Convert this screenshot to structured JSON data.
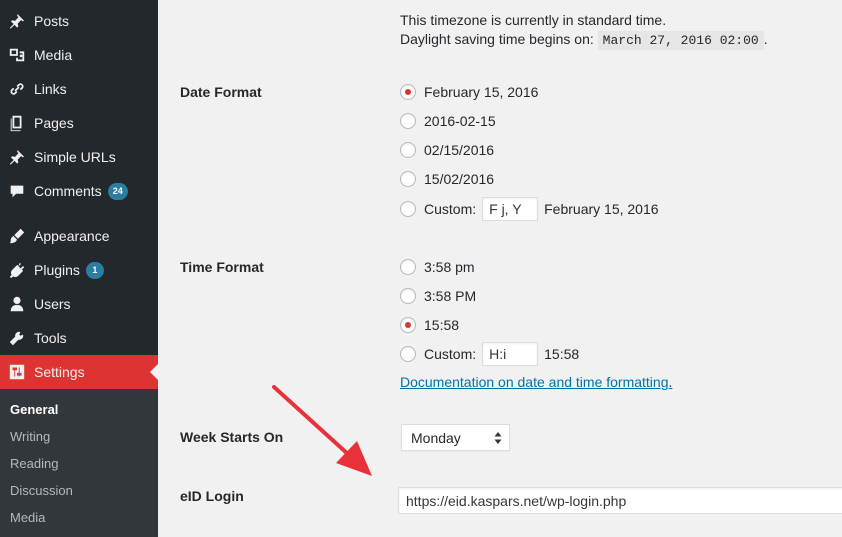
{
  "sidebar": {
    "items": [
      {
        "label": "Posts",
        "icon": "pushpin-icon"
      },
      {
        "label": "Media",
        "icon": "media-icon"
      },
      {
        "label": "Links",
        "icon": "link-icon"
      },
      {
        "label": "Pages",
        "icon": "pages-icon"
      },
      {
        "label": "Simple URLs",
        "icon": "pushpin-icon"
      },
      {
        "label": "Comments",
        "icon": "comment-icon",
        "badge": "24"
      },
      {
        "label": "Appearance",
        "icon": "paintbrush-icon"
      },
      {
        "label": "Plugins",
        "icon": "plugin-icon",
        "badge": "1"
      },
      {
        "label": "Users",
        "icon": "user-icon"
      },
      {
        "label": "Tools",
        "icon": "wrench-icon"
      },
      {
        "label": "Settings",
        "icon": "settings-icon"
      }
    ],
    "submenu": [
      "General",
      "Writing",
      "Reading",
      "Discussion",
      "Media"
    ]
  },
  "timezone": {
    "standard_text": "This timezone is currently in standard time.",
    "dst_prefix": "Daylight saving time begins on:",
    "dst_date": "March 27, 2016 02:00",
    "dst_suffix": "."
  },
  "date_format": {
    "label": "Date Format",
    "options": [
      "February 15, 2016",
      "2016-02-15",
      "02/15/2016",
      "15/02/2016"
    ],
    "custom_label": "Custom:",
    "custom_value": "F j, Y",
    "custom_preview": "February 15, 2016"
  },
  "time_format": {
    "label": "Time Format",
    "options": [
      "3:58 pm",
      "3:58 PM",
      "15:58"
    ],
    "custom_label": "Custom:",
    "custom_value": "H:i",
    "custom_preview": "15:58",
    "doc_link": "Documentation on date and time formatting",
    "doc_suffix": "."
  },
  "week_starts": {
    "label": "Week Starts On",
    "value": "Monday"
  },
  "eid_login": {
    "label": "eID Login",
    "value": "https://eid.kaspars.net/wp-login.php"
  },
  "colors": {
    "sidebar_bg": "#23282d",
    "submenu_bg": "#32373c",
    "accent": "#dd3333",
    "badge": "#2b7ea1",
    "link": "#0073aa",
    "annotation_arrow": "#e8313a"
  }
}
